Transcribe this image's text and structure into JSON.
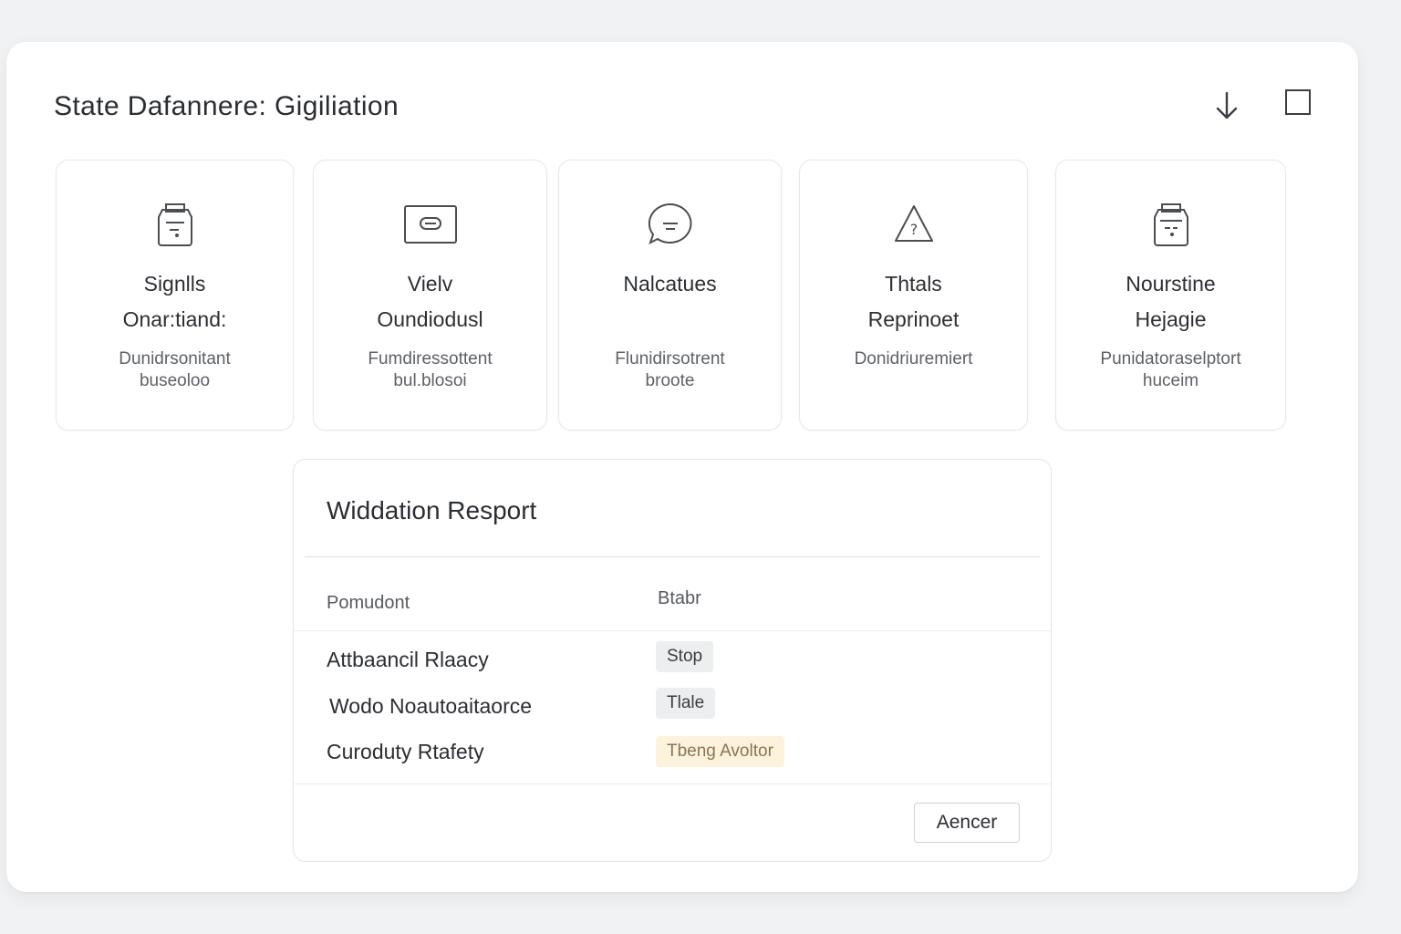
{
  "window": {
    "title": "State Dafannere: Gigiliation",
    "download_icon": "download-arrow-icon",
    "square_icon": "maximize-square-icon"
  },
  "cards": [
    {
      "icon": "clipboard-icon",
      "title_line1": "Signlls",
      "title_line2": "Onar:tiand:",
      "desc_line1": "Dunidrsonitant",
      "desc_line2": "buseoloo"
    },
    {
      "icon": "monitor-icon",
      "title_line1": "Vielv",
      "title_line2": "Oundiodusl",
      "desc_line1": "Fumdiressottent",
      "desc_line2": "bul.blosoi"
    },
    {
      "icon": "chat-bubble-icon",
      "title_line1": "Nalcatues",
      "title_line2": "",
      "desc_line1": "Flunidirsotrent",
      "desc_line2": "broote"
    },
    {
      "icon": "warning-triangle-icon",
      "title_line1": "Thtals",
      "title_line2": "Reprinoet",
      "desc_line1": "Donidriuremiert",
      "desc_line2": ""
    },
    {
      "icon": "document-icon",
      "title_line1": "Nourstine",
      "title_line2": "Hejagie",
      "desc_line1": "Punidatoraselptort",
      "desc_line2": "huceim"
    }
  ],
  "report": {
    "title": "Widdation Resport",
    "col_left": "Pomudont",
    "col_right": "Btabr",
    "rows": [
      {
        "label": "Attbaancil Rlaacy",
        "status": "Stop",
        "tone": "neutral"
      },
      {
        "label": "Wodo Noautoaitaorce",
        "status": "Tlale",
        "tone": "neutral"
      },
      {
        "label": "Curoduty Rtafety",
        "status": "Tbeng Avoltor",
        "tone": "warning",
        "color": "#fdf2dc"
      }
    ],
    "cancel_label": "Aencer"
  }
}
